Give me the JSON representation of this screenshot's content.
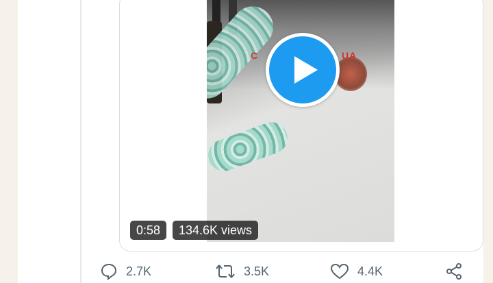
{
  "video": {
    "duration": "0:58",
    "views": "134.6K views",
    "overlay_left": "C",
    "overlay_right": "UA"
  },
  "actions": {
    "reply_count": "2.7K",
    "retweet_count": "3.5K",
    "like_count": "4.4K"
  },
  "colors": {
    "accent": "#1d9bf0",
    "icon_gray": "#536471",
    "background": "#f6f2ea"
  },
  "icons": [
    "play-icon",
    "reply-icon",
    "retweet-icon",
    "like-icon",
    "share-icon"
  ]
}
